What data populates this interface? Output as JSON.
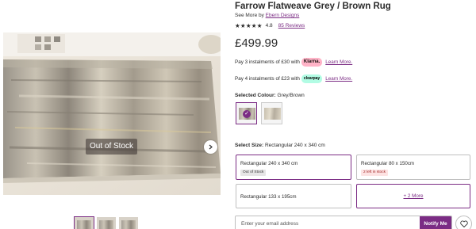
{
  "gallery": {
    "status_overlay": "Out of Stock",
    "next_icon": "chevron-right-icon",
    "thumbnails": 3
  },
  "product": {
    "title": "Farrow Flatweave Grey / Brown Rug",
    "see_more_prefix": "See More by",
    "brand": "Ebern Designs",
    "rating": "4.8",
    "reviews": "85 Reviews",
    "price": "£499.99"
  },
  "payments": {
    "klarna": {
      "text": "Pay 3 instalments of £30 with",
      "badge": "Klarna.",
      "link": "Learn More."
    },
    "clearpay": {
      "text": "Pay 4 instalments of £23 with",
      "badge": "clearpay",
      "link": "Learn More."
    }
  },
  "colour": {
    "label": "Selected Colour:",
    "value": "Grey/Brown",
    "check_icon": "checkmark-icon"
  },
  "size": {
    "label": "Select Size:",
    "value": "Rectangular 240 x 340 cm",
    "options": [
      {
        "name": "Rectangular 240 x 340 cm",
        "badge": "Out of Stock"
      },
      {
        "name": "Rectangular 80 x 150cm",
        "badge": "2 left in stock"
      },
      {
        "name": "Rectangular 133 x 195cm",
        "badge": ""
      }
    ],
    "more_link": "+ 2 More"
  },
  "notify": {
    "placeholder": "Enter your email address",
    "button": "Notify Me",
    "wishlist_icon": "heart-icon"
  },
  "colors": {
    "accent": "#7b2c84",
    "klarna": "#ffb3c7",
    "clearpay": "#b2fce4"
  }
}
